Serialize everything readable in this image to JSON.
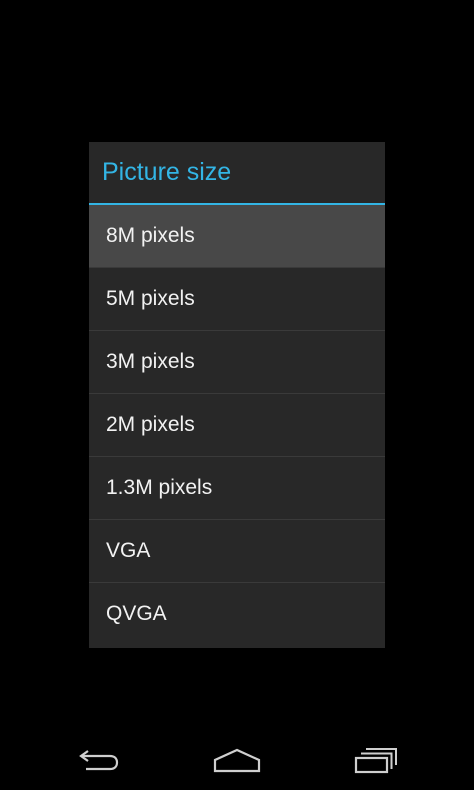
{
  "dialog": {
    "title": "Picture size",
    "options": [
      {
        "label": "8M pixels",
        "selected": true
      },
      {
        "label": "5M pixels",
        "selected": false
      },
      {
        "label": "3M pixels",
        "selected": false
      },
      {
        "label": "2M pixels",
        "selected": false
      },
      {
        "label": "1.3M pixels",
        "selected": false
      },
      {
        "label": "VGA",
        "selected": false
      },
      {
        "label": "QVGA",
        "selected": false
      }
    ]
  },
  "colors": {
    "accent": "#33b5e5",
    "dialog_background": "#282828",
    "selected_background": "#484848",
    "text": "#f2f2f2"
  },
  "navbar": {
    "icons": [
      "back-icon",
      "home-icon",
      "recent-apps-icon"
    ]
  }
}
